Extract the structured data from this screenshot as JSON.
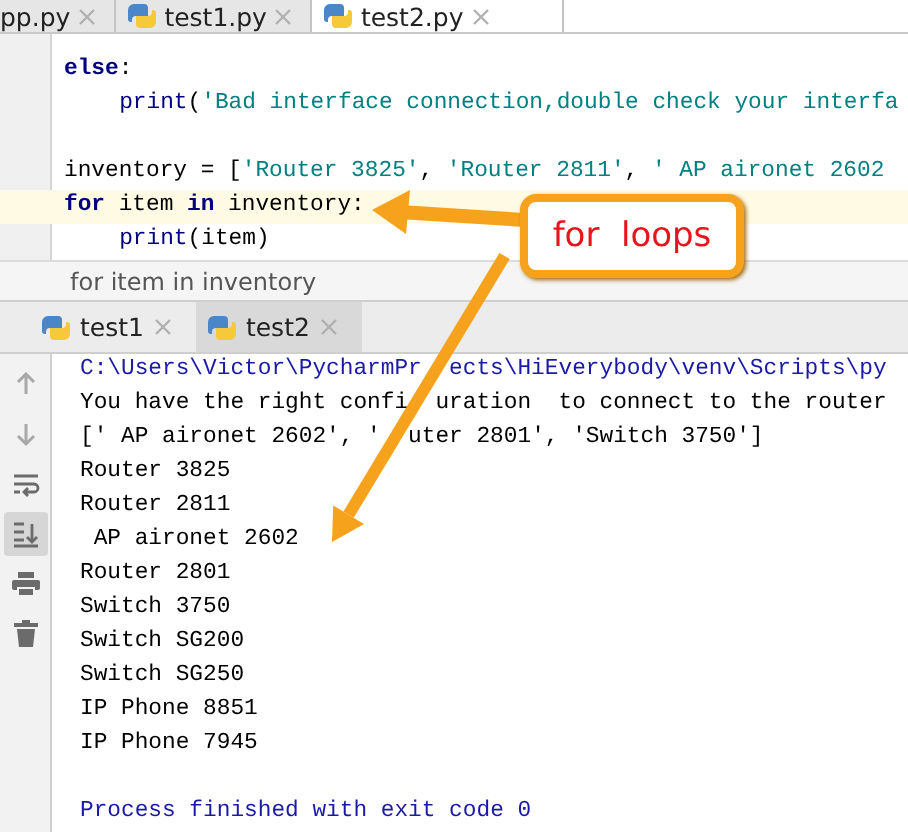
{
  "editor_tabs": [
    {
      "label": "pp.py",
      "selected": false,
      "icon": false
    },
    {
      "label": "test1.py",
      "selected": false,
      "icon": true
    },
    {
      "label": "test2.py",
      "selected": true,
      "icon": true
    }
  ],
  "code_lines": [
    {
      "kind": "code",
      "highlighted": false,
      "tokens": [
        {
          "kind": "keyword",
          "text": "else"
        },
        {
          "kind": "plain",
          "text": ":"
        }
      ]
    },
    {
      "kind": "code",
      "highlighted": false,
      "indented": true,
      "tokens": [
        {
          "kind": "builtin",
          "text": "print"
        },
        {
          "kind": "plain",
          "text": "("
        },
        {
          "kind": "string",
          "text": "'Bad interface connection,double check your interfa"
        }
      ]
    },
    {
      "kind": "blank"
    },
    {
      "kind": "code",
      "highlighted": false,
      "tokens": [
        {
          "kind": "plain",
          "text": "inventory = ["
        },
        {
          "kind": "string",
          "text": "'Router 3825'"
        },
        {
          "kind": "plain",
          "text": ", "
        },
        {
          "kind": "string",
          "text": "'Router 2811'"
        },
        {
          "kind": "plain",
          "text": ", "
        },
        {
          "kind": "string",
          "text": "' AP aironet 2602"
        }
      ]
    },
    {
      "kind": "code",
      "highlighted": true,
      "tokens": [
        {
          "kind": "keyword",
          "text": "for"
        },
        {
          "kind": "plain",
          "text": " item "
        },
        {
          "kind": "keyword",
          "text": "in"
        },
        {
          "kind": "plain",
          "text": " inventory:"
        }
      ]
    },
    {
      "kind": "code",
      "highlighted": false,
      "indented": true,
      "tokens": [
        {
          "kind": "builtin",
          "text": "print"
        },
        {
          "kind": "plain",
          "text": "(item)"
        }
      ]
    }
  ],
  "breadcrumb": "for item in inventory",
  "run_tabs": [
    {
      "label": "test1",
      "selected": false
    },
    {
      "label": "test2",
      "selected": true
    }
  ],
  "run_toolbar": [
    {
      "kind": "up",
      "on": false
    },
    {
      "kind": "down",
      "on": false
    },
    {
      "kind": "wrap",
      "on": false
    },
    {
      "kind": "scroll-end",
      "on": true
    },
    {
      "kind": "print",
      "on": false
    },
    {
      "kind": "trash",
      "on": false
    }
  ],
  "console_lines": [
    {
      "kind": "system",
      "parts": [
        "C:\\Users\\Victor\\PycharmPr",
        "ects\\HiEverybody\\venv\\Scripts\\py"
      ]
    },
    {
      "kind": "output",
      "parts": [
        "You have the right confi",
        "uration  to connect to the router"
      ]
    },
    {
      "kind": "output",
      "parts": [
        "[' AP aironet 2602', '",
        "uter 2801', 'Switch 3750']"
      ]
    },
    {
      "kind": "output",
      "text": "Router 3825"
    },
    {
      "kind": "output",
      "text": "Router 2811"
    },
    {
      "kind": "output",
      "text": " AP aironet 2602"
    },
    {
      "kind": "output",
      "text": "Router 2801"
    },
    {
      "kind": "output",
      "text": "Switch 3750"
    },
    {
      "kind": "output",
      "text": "Switch SG200"
    },
    {
      "kind": "output",
      "text": "Switch SG250"
    },
    {
      "kind": "output",
      "text": "IP Phone 8851"
    },
    {
      "kind": "output",
      "text": "IP Phone 7945"
    },
    {
      "kind": "blank"
    },
    {
      "kind": "system",
      "text": "Process finished with exit code 0"
    }
  ],
  "callout": {
    "text": "for  loops"
  }
}
